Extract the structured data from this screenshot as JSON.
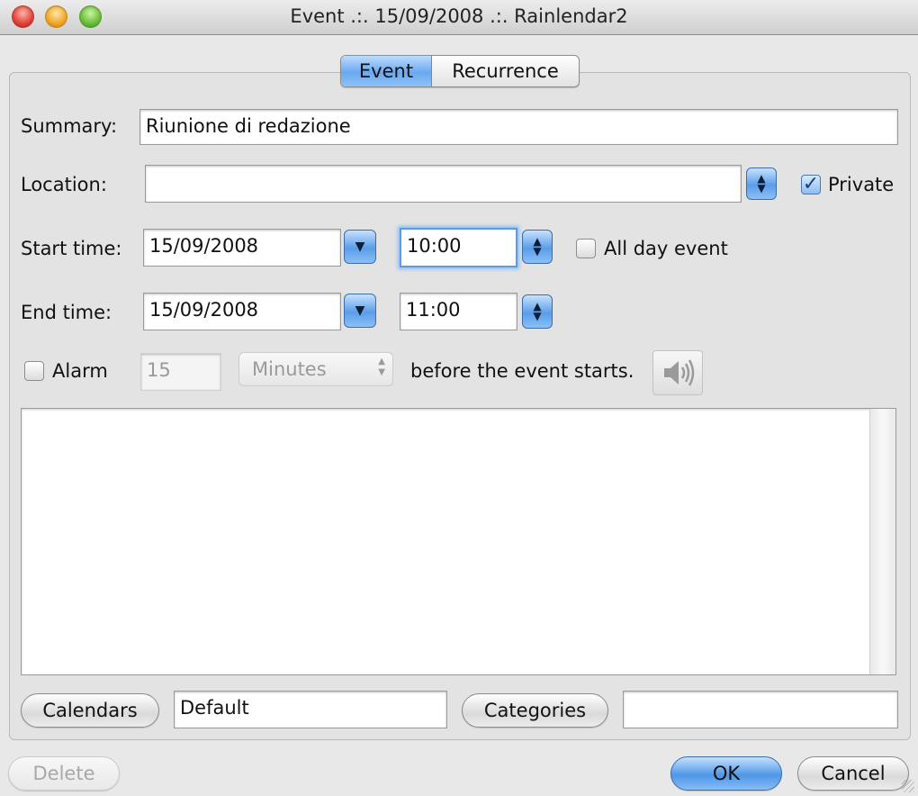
{
  "window": {
    "title": "Event .:. 15/09/2008 .:. Rainlendar2"
  },
  "tabs": [
    {
      "label": "Event"
    },
    {
      "label": "Recurrence"
    }
  ],
  "form": {
    "summary_label": "Summary:",
    "summary_value": "Riunione di redazione",
    "location_label": "Location:",
    "location_value": "",
    "private_label": "Private",
    "private_checked": true,
    "start_label": "Start time:",
    "start_date": "15/09/2008",
    "start_time": "10:00",
    "allday_label": "All day event",
    "allday_checked": false,
    "end_label": "End time:",
    "end_date": "15/09/2008",
    "end_time": "11:00",
    "alarm_label": "Alarm",
    "alarm_checked": false,
    "alarm_amount": "15",
    "alarm_unit": "Minutes",
    "alarm_suffix": "before the event starts."
  },
  "bottom": {
    "calendars_button": "Calendars",
    "calendars_value": "Default",
    "categories_button": "Categories",
    "categories_value": ""
  },
  "actions": {
    "delete": "Delete",
    "ok": "OK",
    "cancel": "Cancel"
  }
}
